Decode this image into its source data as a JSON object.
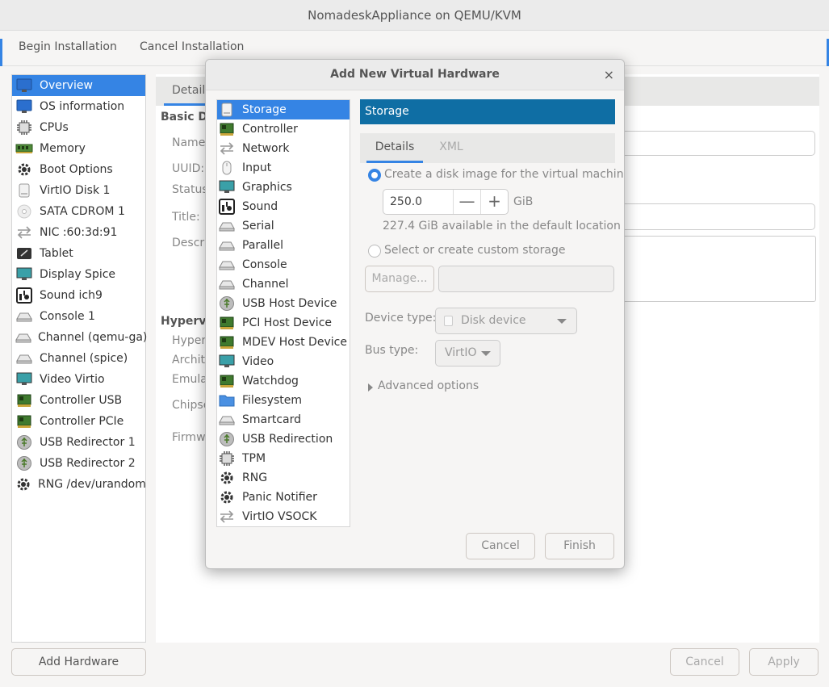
{
  "window": {
    "title": "NomadeskAppliance on QEMU/KVM"
  },
  "menu": {
    "begin": "Begin Installation",
    "cancel": "Cancel Installation"
  },
  "hardware_list": [
    {
      "label": "Overview",
      "icon": "monitor-icon",
      "selected": true
    },
    {
      "label": "OS information",
      "icon": "monitor-icon"
    },
    {
      "label": "CPUs",
      "icon": "cpu-icon"
    },
    {
      "label": "Memory",
      "icon": "memory-icon"
    },
    {
      "label": "Boot Options",
      "icon": "gear-icon"
    },
    {
      "label": "VirtIO Disk 1",
      "icon": "disk-icon"
    },
    {
      "label": "SATA CDROM 1",
      "icon": "cdrom-icon"
    },
    {
      "label": "NIC :60:3d:91",
      "icon": "network-icon"
    },
    {
      "label": "Tablet",
      "icon": "tablet-icon"
    },
    {
      "label": "Display Spice",
      "icon": "display-icon"
    },
    {
      "label": "Sound ich9",
      "icon": "sound-icon"
    },
    {
      "label": "Console 1",
      "icon": "serial-icon"
    },
    {
      "label": "Channel (qemu-ga)",
      "icon": "serial-icon"
    },
    {
      "label": "Channel (spice)",
      "icon": "serial-icon"
    },
    {
      "label": "Video Virtio",
      "icon": "display-icon"
    },
    {
      "label": "Controller USB",
      "icon": "pci-card-icon"
    },
    {
      "label": "Controller PCIe",
      "icon": "pci-card-icon"
    },
    {
      "label": "USB Redirector 1",
      "icon": "usb-icon"
    },
    {
      "label": "USB Redirector 2",
      "icon": "usb-icon"
    },
    {
      "label": "RNG /dev/urandom",
      "icon": "gear-icon"
    }
  ],
  "details": {
    "tab": "Details",
    "basic_header": "Basic De",
    "name": "Name:",
    "uuid": "UUID:",
    "status": "Status",
    "title": "Title:",
    "description": "Descri",
    "hypervisor_header": "Hypervis",
    "hyper": "Hyper",
    "arch": "Archit",
    "emul": "Emula",
    "chipset": "Chipse",
    "firmware": "Firmw"
  },
  "buttons": {
    "add_hardware": "Add Hardware",
    "cancel": "Cancel",
    "apply": "Apply"
  },
  "dialog": {
    "title": "Add New Virtual Hardware",
    "close": "×",
    "types": [
      {
        "label": "Storage",
        "icon": "disk-icon",
        "selected": true
      },
      {
        "label": "Controller",
        "icon": "pci-card-icon"
      },
      {
        "label": "Network",
        "icon": "network-icon"
      },
      {
        "label": "Input",
        "icon": "mouse-icon"
      },
      {
        "label": "Graphics",
        "icon": "display-icon"
      },
      {
        "label": "Sound",
        "icon": "sound-icon"
      },
      {
        "label": "Serial",
        "icon": "serial-icon"
      },
      {
        "label": "Parallel",
        "icon": "serial-icon"
      },
      {
        "label": "Console",
        "icon": "serial-icon"
      },
      {
        "label": "Channel",
        "icon": "serial-icon"
      },
      {
        "label": "USB Host Device",
        "icon": "usb-icon"
      },
      {
        "label": "PCI Host Device",
        "icon": "pci-card-icon"
      },
      {
        "label": "MDEV Host Device",
        "icon": "pci-card-icon"
      },
      {
        "label": "Video",
        "icon": "display-icon"
      },
      {
        "label": "Watchdog",
        "icon": "pci-card-icon"
      },
      {
        "label": "Filesystem",
        "icon": "folder-icon"
      },
      {
        "label": "Smartcard",
        "icon": "serial-icon"
      },
      {
        "label": "USB Redirection",
        "icon": "usb-icon"
      },
      {
        "label": "TPM",
        "icon": "cpu-icon"
      },
      {
        "label": "RNG",
        "icon": "gear-icon"
      },
      {
        "label": "Panic Notifier",
        "icon": "gear-icon"
      },
      {
        "label": "VirtIO VSOCK",
        "icon": "network-icon"
      }
    ],
    "storage": {
      "header": "Storage",
      "tab_details": "Details",
      "tab_xml": "XML",
      "opt_create": "Create a disk image for the virtual machine",
      "size_value": "250.0",
      "size_unit": "GiB",
      "minus": "—",
      "plus": "+",
      "available": "227.4 GiB available in the default location",
      "opt_custom": "Select or create custom storage",
      "manage": "Manage...",
      "device_type_label": "Device type:",
      "device_type_value": "Disk device",
      "bus_type_label": "Bus type:",
      "bus_type_value": "VirtIO",
      "advanced": "Advanced options"
    },
    "cancel": "Cancel",
    "finish": "Finish"
  },
  "colors": {
    "accent": "#3584e4",
    "storage_header": "#0f6ea4"
  }
}
